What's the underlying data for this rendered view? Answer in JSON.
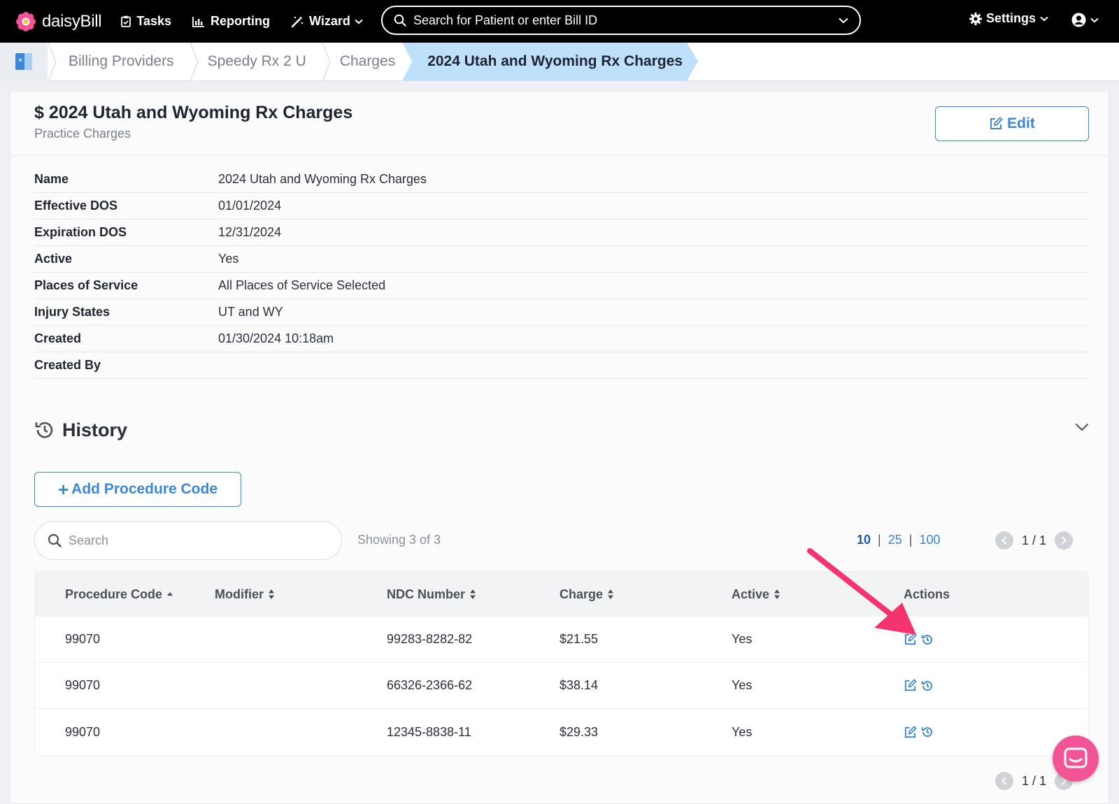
{
  "topnav": {
    "logo_text": "daisyBill",
    "tasks": "Tasks",
    "reporting": "Reporting",
    "wizard": "Wizard",
    "search_placeholder": "Search for Patient or enter Bill ID",
    "settings": "Settings"
  },
  "breadcrumb": {
    "items": [
      "Billing Providers",
      "Speedy Rx 2 U",
      "Charges"
    ],
    "active": "2024 Utah and Wyoming Rx Charges"
  },
  "header": {
    "title": "$ 2024 Utah and Wyoming Rx Charges",
    "subtitle": "Practice Charges",
    "edit_label": "Edit"
  },
  "details": [
    {
      "label": "Name",
      "value": "2024 Utah and Wyoming Rx Charges"
    },
    {
      "label": "Effective DOS",
      "value": "01/01/2024"
    },
    {
      "label": "Expiration DOS",
      "value": "12/31/2024"
    },
    {
      "label": "Active",
      "value": "Yes"
    },
    {
      "label": "Places of Service",
      "value": "All Places of Service Selected"
    },
    {
      "label": "Injury States",
      "value": "UT and WY"
    },
    {
      "label": "Created",
      "value": "01/30/2024 10:18am"
    },
    {
      "label": "Created By",
      "value": ""
    }
  ],
  "history": {
    "title": "History"
  },
  "add_button": {
    "plus": "+",
    "label": "Add Procedure Code"
  },
  "table_search": {
    "placeholder": "Search"
  },
  "showing": "Showing 3 of 3",
  "page_sizes": {
    "a": "10",
    "b": "25",
    "c": "100",
    "sep": "|"
  },
  "pager": {
    "label": "1 / 1"
  },
  "table": {
    "headers": {
      "procedure_code": "Procedure Code",
      "modifier": "Modifier",
      "ndc": "NDC Number",
      "charge": "Charge",
      "active": "Active",
      "actions": "Actions"
    },
    "rows": [
      {
        "code": "99070",
        "modifier": "",
        "ndc": "99283-8282-82",
        "charge": "$21.55",
        "active": "Yes"
      },
      {
        "code": "99070",
        "modifier": "",
        "ndc": "66326-2366-62",
        "charge": "$38.14",
        "active": "Yes"
      },
      {
        "code": "99070",
        "modifier": "",
        "ndc": "12345-8838-11",
        "charge": "$29.33",
        "active": "Yes"
      }
    ]
  },
  "colors": {
    "accent": "#3a87d6",
    "breadcrumb_active": "#bfe0fb",
    "annotation_arrow": "#f5336e",
    "chat": "#f25596"
  }
}
